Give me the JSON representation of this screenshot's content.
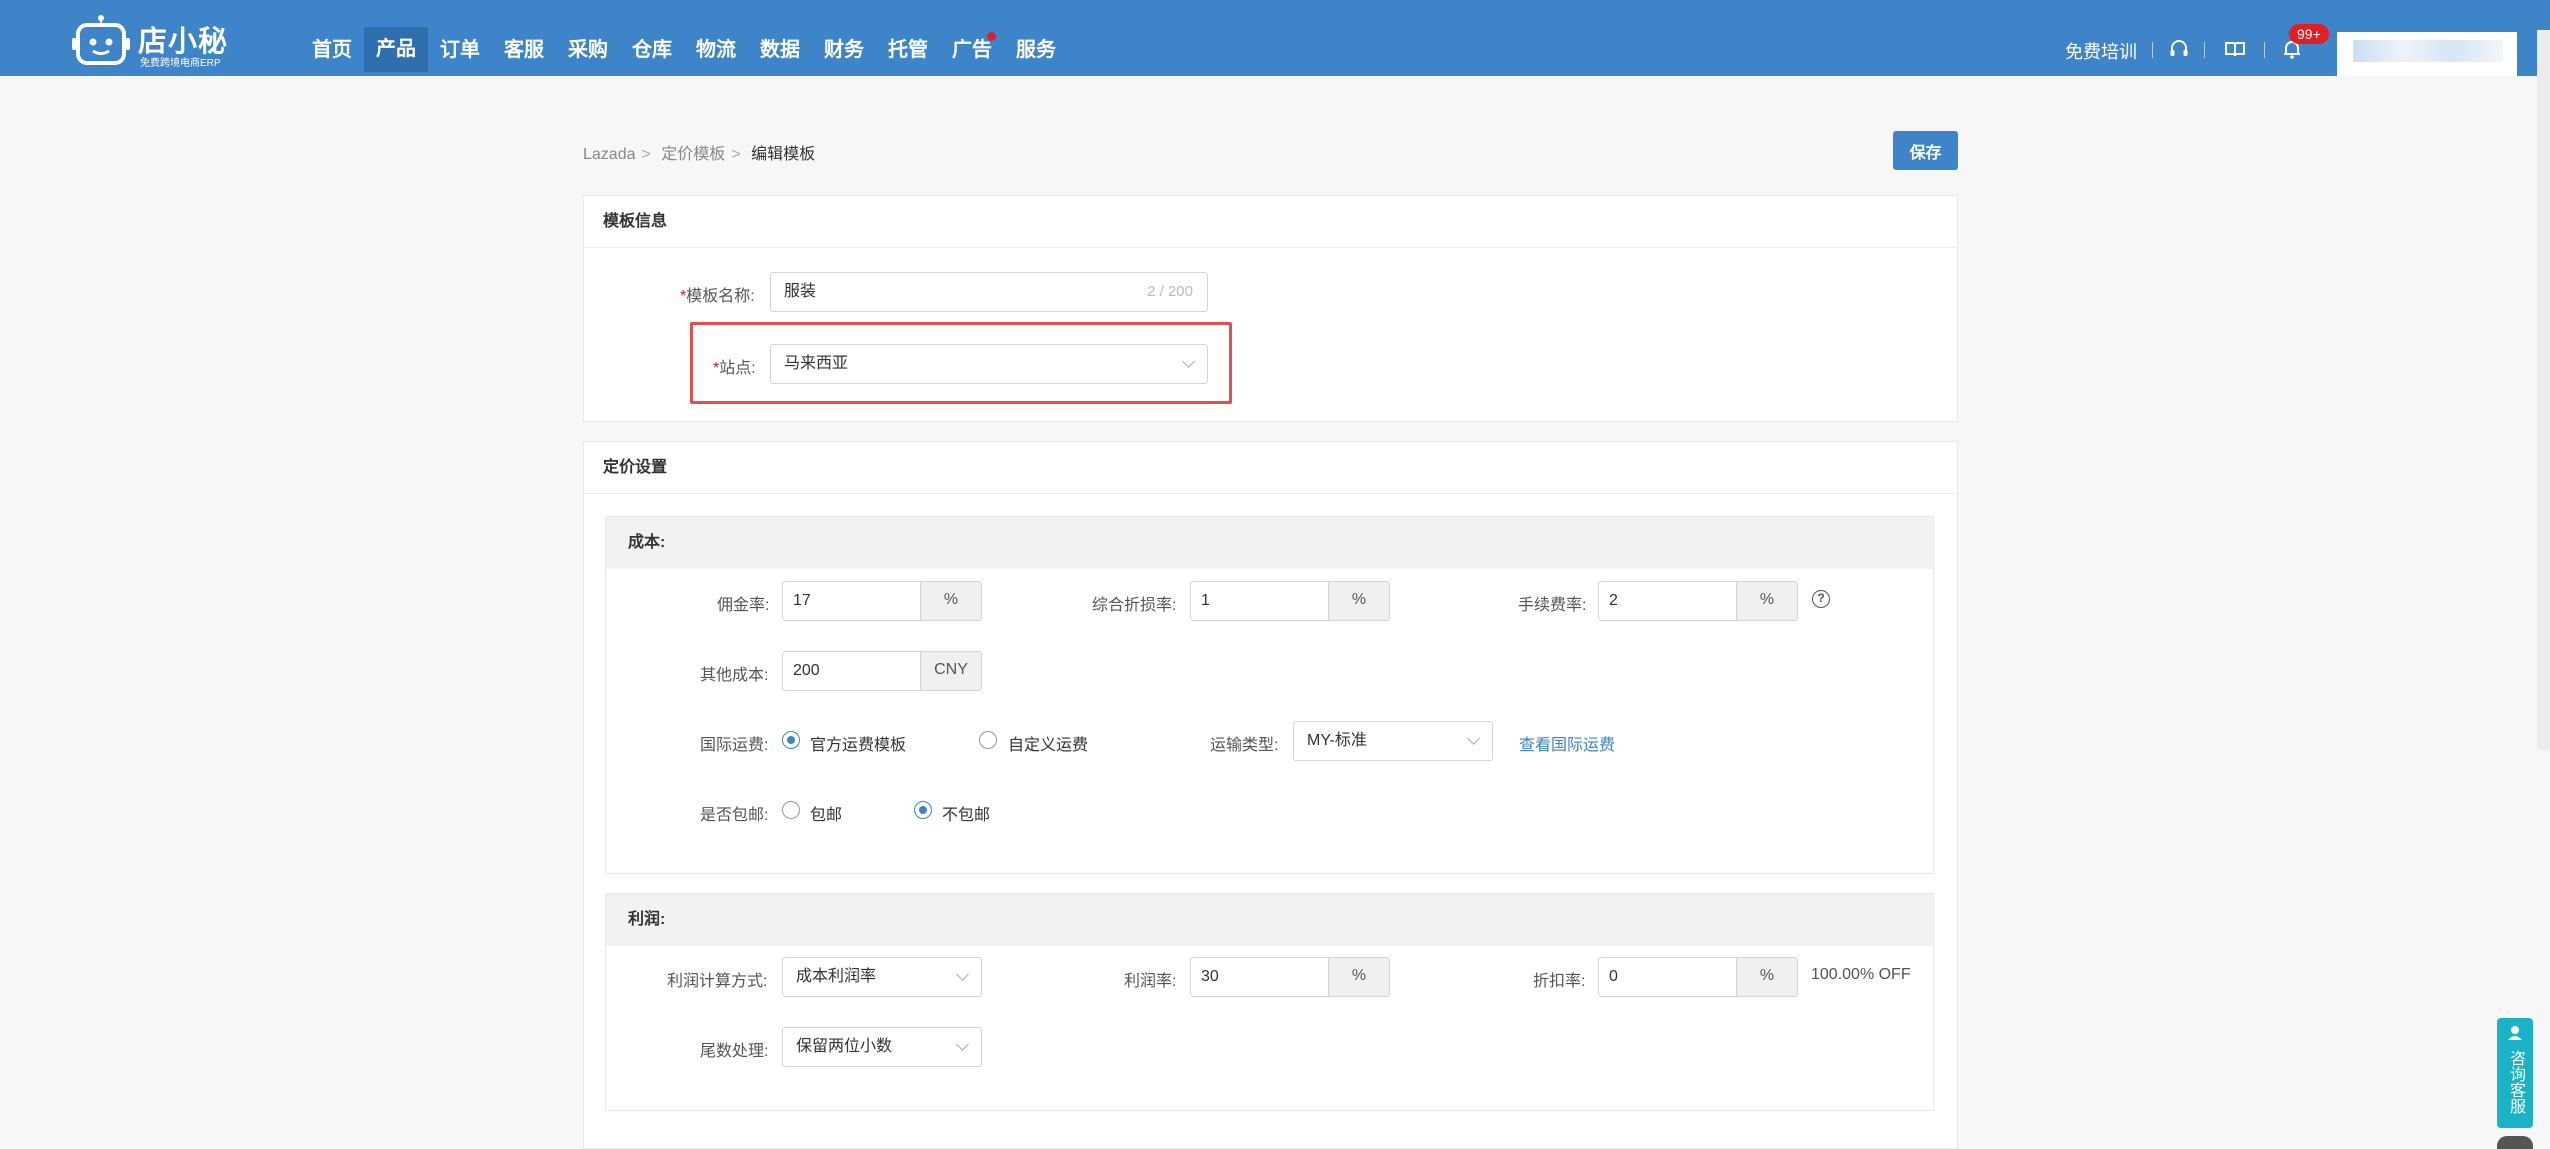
{
  "brand": {
    "name": "店小秘",
    "slogan": "免费跨境电商ERP"
  },
  "nav": {
    "items": [
      "首页",
      "产品",
      "订单",
      "客服",
      "采购",
      "仓库",
      "物流",
      "数据",
      "财务",
      "托管",
      "广告",
      "服务"
    ],
    "active": "产品"
  },
  "topright": {
    "training": "免费培训",
    "badge": "99+"
  },
  "breadcrumb": {
    "l1": "Lazada",
    "l2": "定价模板",
    "l3": "编辑模板"
  },
  "save_label": "保存",
  "template_info": {
    "title": "模板信息",
    "name_label": "模板名称:",
    "name_value": "服装",
    "name_counter": "2 / 200",
    "site_label": "站点:",
    "site_value": "马来西亚"
  },
  "pricing": {
    "title": "定价设置",
    "cost": {
      "title": "成本:",
      "commission_label": "佣金率:",
      "commission_value": "17",
      "commission_unit": "%",
      "loss_label": "综合折损率:",
      "loss_value": "1",
      "loss_unit": "%",
      "fee_label": "手续费率:",
      "fee_value": "2",
      "fee_unit": "%",
      "help": "?",
      "other_label": "其他成本:",
      "other_value": "200",
      "other_unit": "CNY",
      "intl_label": "国际运费:",
      "intl_opt1": "官方运费模板",
      "intl_opt2": "自定义运费",
      "ship_type_label": "运输类型:",
      "ship_type_value": "MY-标准",
      "view_intl": "查看国际运费",
      "free_ship_label": "是否包邮:",
      "free_opt1": "包邮",
      "free_opt2": "不包邮"
    },
    "profit": {
      "title": "利润:",
      "calc_label": "利润计算方式:",
      "calc_value": "成本利润率",
      "rate_label": "利润率:",
      "rate_value": "30",
      "rate_unit": "%",
      "discount_label": "折扣率:",
      "discount_value": "0",
      "discount_unit": "%",
      "discount_off": "100.00% OFF",
      "round_label": "尾数处理:",
      "round_value": "保留两位小数"
    }
  },
  "cs": {
    "label": "咨询客服"
  },
  "colors": {
    "primary": "#3d85c8",
    "highlight": "#e84c4c",
    "badge": "#e31e24",
    "cs": "#19b2c6"
  }
}
